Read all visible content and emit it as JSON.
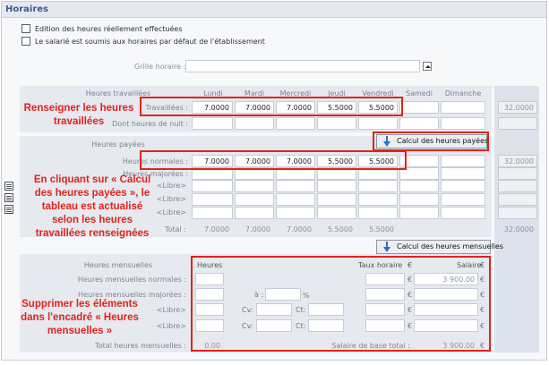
{
  "window": {
    "title": "Horaires"
  },
  "options": {
    "edition_label": "Edition des heures réellement effectuées",
    "default_schedule_label": "Le salarié est soumis aux horaires par défaut de l'établissement",
    "grille_label": "Grille horaire :"
  },
  "days": [
    "Lundi",
    "Mardi",
    "Mercredi",
    "Jeudi",
    "Vendredi",
    "Samedi",
    "Dimanche"
  ],
  "worked": {
    "header": "Heures travaillées",
    "row_label": "Travaillées :",
    "values": [
      "7.0000",
      "7.0000",
      "7.0000",
      "5.5000",
      "5.5000",
      "",
      ""
    ],
    "total": "32.0000",
    "night_label": "Dont heures de nuit :"
  },
  "paid": {
    "header": "Heures payées",
    "normal_label": "Heures normales :",
    "normal_values": [
      "7.0000",
      "7.0000",
      "7.0000",
      "5.5000",
      "5.5000",
      "",
      ""
    ],
    "normal_total": "32.0000",
    "majorees_label": "Heures majorées :",
    "libre_label": "<Libre>",
    "total_label": "Total :",
    "total_values": [
      "7.0000",
      "7.0000",
      "7.0000",
      "5.5000",
      "5.5000",
      "",
      ""
    ],
    "total_sum": "32.0000",
    "calc_button": "Calcul des heures payées"
  },
  "monthly": {
    "calc_button": "Calcul des heures mensuelles",
    "header": "Heures mensuelles",
    "col_heures": "Heures",
    "col_taux": "Taux horaire",
    "col_salaire": "Salaire",
    "currency": "€",
    "normales_label": "Heures mensuelles normales :",
    "normales_salary": "3 900.00",
    "majorees_label": "Heures mensuelles majorées :",
    "a_label": "à :",
    "percent": "%",
    "libre_label": "<Libre>",
    "cv_label": "Cv:",
    "ct_label": "Ct:",
    "total_label": "Total heures mensuelles :",
    "total_heures": "0.00",
    "salaire_base_label": "Salaire de base total :",
    "salaire_base": "3 900.00"
  },
  "annotations": {
    "a1_line1": "Renseigner les heures",
    "a1_line2": "travaillées",
    "a2_line1": "En cliquant sur « Calcul",
    "a2_line2": "des heures payées », le",
    "a2_line3": "tableau est actualisé",
    "a2_line4": "selon les heures",
    "a2_line5": "travaillées renseignées",
    "a3_line1": "Supprimer les éléments",
    "a3_line2": "dans l'encadré « Heures",
    "a3_line3": "mensuelles »"
  },
  "colors": {
    "annotation_red": "#e2231a",
    "section_blue": "#3b5b8c",
    "panel": "#e6e9ef"
  }
}
